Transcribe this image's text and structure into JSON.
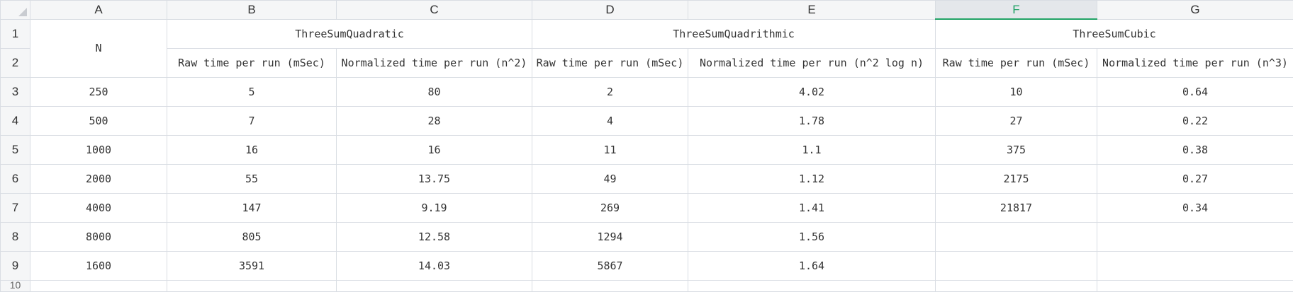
{
  "column_headers": [
    "A",
    "B",
    "C",
    "D",
    "E",
    "F",
    "G"
  ],
  "selected_column": "F",
  "row_headers": [
    "1",
    "2",
    "3",
    "4",
    "5",
    "6",
    "7",
    "8",
    "9",
    "10"
  ],
  "header_cells": {
    "a1": "N",
    "quadratic": "ThreeSumQuadratic",
    "quadrithmic": "ThreeSumQuadrithmic",
    "cubic": "ThreeSumCubic",
    "b2": "Raw time per run (mSec)",
    "c2": "Normalized time per run (n^2)",
    "d2": "Raw time per run (mSec)",
    "e2": "Normalized time per run (n^2 log n)",
    "f2": "Raw time per run (mSec)",
    "g2": "Normalized time per run (n^3)"
  },
  "rows": [
    [
      "250",
      "5",
      "80",
      "2",
      "4.02",
      "10",
      "0.64"
    ],
    [
      "500",
      "7",
      "28",
      "4",
      "1.78",
      "27",
      "0.22"
    ],
    [
      "1000",
      "16",
      "16",
      "11",
      "1.1",
      "375",
      "0.38"
    ],
    [
      "2000",
      "55",
      "13.75",
      "49",
      "1.12",
      "2175",
      "0.27"
    ],
    [
      "4000",
      "147",
      "9.19",
      "269",
      "1.41",
      "21817",
      "0.34"
    ],
    [
      "8000",
      "805",
      "12.58",
      "1294",
      "1.56",
      "",
      ""
    ],
    [
      "1600",
      "3591",
      "14.03",
      "5867",
      "1.64",
      "",
      ""
    ]
  ],
  "colors": {
    "grid": "#d9dde3",
    "header_bg": "#f5f6f7",
    "selected_accent": "#21a366"
  }
}
